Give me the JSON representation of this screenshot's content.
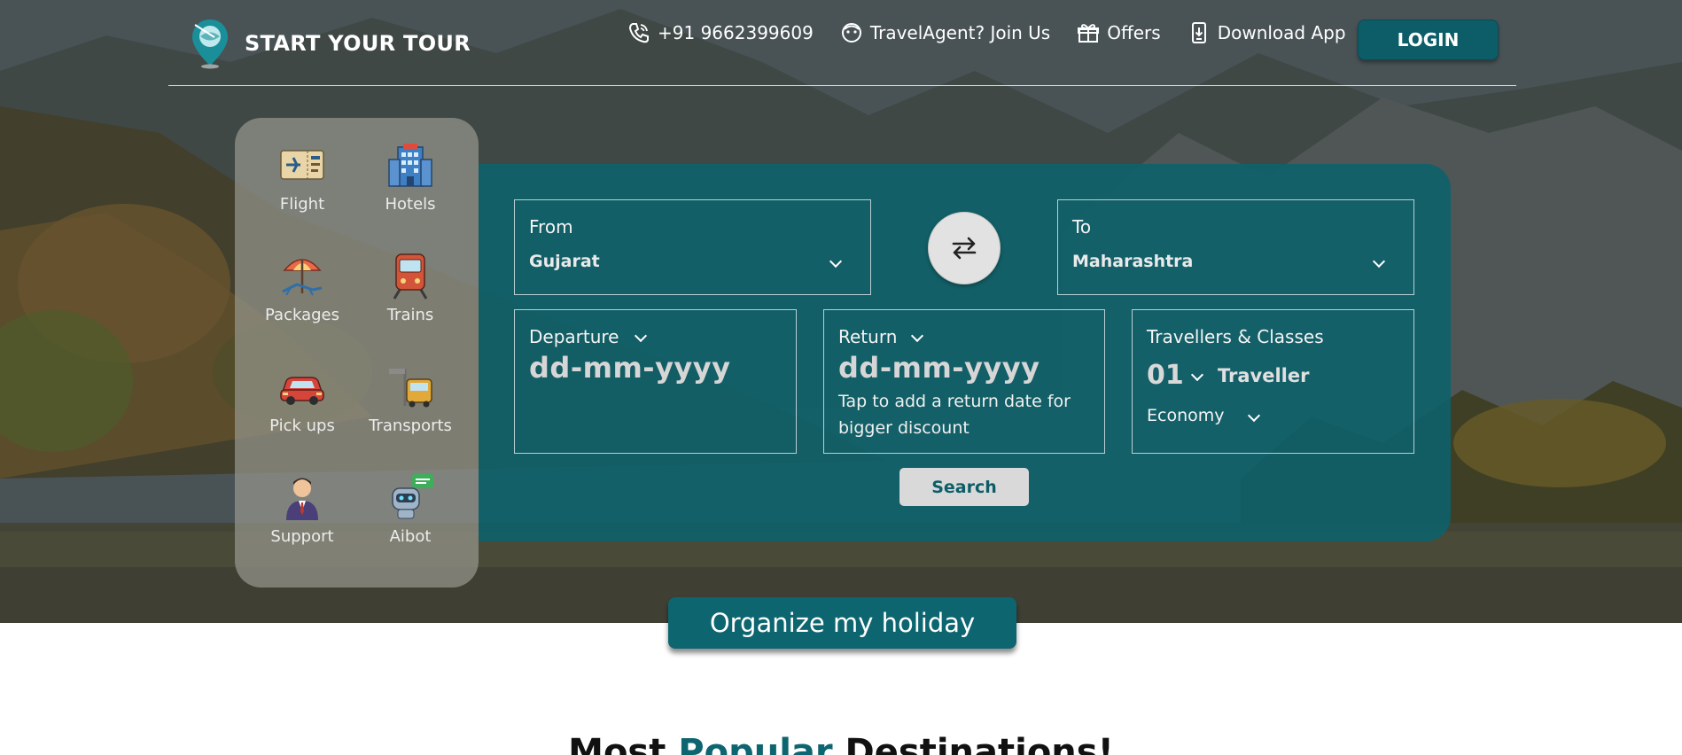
{
  "brand": {
    "title": "START YOUR TOUR",
    "logo_icon": "map-pin-globe-icon"
  },
  "header": {
    "links": [
      {
        "icon": "phone-icon",
        "label": "+91 9662399609"
      },
      {
        "icon": "agent-icon",
        "label": "TravelAgent? Join Us"
      },
      {
        "icon": "gift-icon",
        "label": "Offers"
      },
      {
        "icon": "mobile-download-icon",
        "label": "Download App"
      }
    ],
    "login_label": "LOGIN"
  },
  "side_menu": {
    "items": [
      {
        "label": "Flight",
        "icon": "flight-ticket-icon"
      },
      {
        "label": "Hotels",
        "icon": "hotel-building-icon"
      },
      {
        "label": "Packages",
        "icon": "beach-umbrella-icon"
      },
      {
        "label": "Trains",
        "icon": "train-icon"
      },
      {
        "label": "Pick ups",
        "icon": "car-icon"
      },
      {
        "label": "Transports",
        "icon": "bus-stop-icon"
      },
      {
        "label": "Support",
        "icon": "support-agent-icon"
      },
      {
        "label": "Aibot",
        "icon": "robot-chat-icon"
      }
    ]
  },
  "search": {
    "from": {
      "label": "From",
      "value": "Gujarat"
    },
    "to": {
      "label": "To",
      "value": "Maharashtra"
    },
    "departure": {
      "label": "Departure",
      "placeholder": "dd-mm-yyyy"
    },
    "return": {
      "label": "Return",
      "placeholder": "dd-mm-yyyy",
      "hint": "Tap to add a return date for bigger discount"
    },
    "travellers": {
      "label": "Travellers & Classes",
      "count": "01",
      "unit": "Traveller",
      "class": "Economy"
    },
    "search_label": "Search"
  },
  "organize_label": "Organize my holiday",
  "section": {
    "title_prefix": "Most ",
    "title_accent": "Popular",
    "title_suffix": " Destinations!"
  },
  "colors": {
    "brand_teal": "#0d5d68",
    "panel_teal": "#0c626c",
    "accent": "#0d6570"
  }
}
